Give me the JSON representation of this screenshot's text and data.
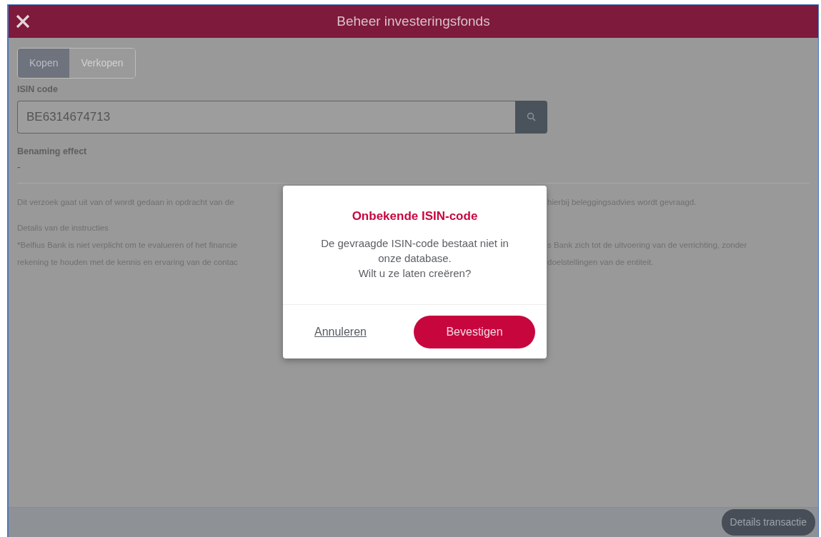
{
  "window": {
    "title": "Beheer investeringsfonds"
  },
  "tabs": [
    {
      "label": "Kopen",
      "selected": true
    },
    {
      "label": "Verkopen",
      "selected": false
    }
  ],
  "isin": {
    "label": "ISIN code",
    "value": "BE6314674713"
  },
  "effect": {
    "label": "Benaming effect",
    "value": "-"
  },
  "notice": {
    "left": "Dit verzoek gaat uit van of wordt gedaan in opdracht van de",
    "right": "hierbij beleggingsadvies wordt gevraagd."
  },
  "details": {
    "heading": "Details van de instructies",
    "lines": [
      {
        "left": "*Belfius Bank is niet verplicht om te evalueren of het financie",
        "right": "s Bank zich tot de uitvoering van de verrichting, zonder"
      },
      {
        "left": "rekening te houden met de kennis en ervaring van de contac",
        "right": "doelstellingen van de entiteit."
      }
    ]
  },
  "dialog": {
    "title": "Onbekende ISIN-code",
    "message": [
      "De gevraagde ISIN-code bestaat niet in onze database.",
      "Wilt u ze laten creëren?"
    ],
    "cancel": "Annuleren",
    "confirm": "Bevestigen"
  },
  "footer": {
    "button": "Details transactie"
  }
}
